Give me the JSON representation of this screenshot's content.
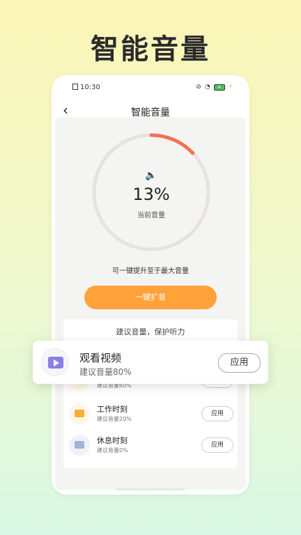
{
  "headline": "智能音量",
  "status_bar": {
    "time": "10:30",
    "battery": "4"
  },
  "nav": {
    "title": "智能音量"
  },
  "volume": {
    "percent_text": "13%",
    "label": "当前音量",
    "level": 0.13
  },
  "hint": "可一键提升至于最大音量",
  "boost_button": "一键扩音",
  "suggest": {
    "title": "建议音量，保护听力",
    "apply_label": "应用",
    "items": [
      {
        "name": "",
        "sub": "建议音量60%"
      },
      {
        "name": "工作时刻",
        "sub": "建议音量20%"
      },
      {
        "name": "休息时刻",
        "sub": "建议音量0%"
      }
    ]
  },
  "popup": {
    "name": "观看视频",
    "sub": "建议音量80%",
    "apply_label": "应用"
  },
  "colors": {
    "accent": "#ffa23a",
    "ring_progress": "#f4714f",
    "ring_track": "#e9e2dc",
    "video_icon": "#8a7fe8"
  },
  "icons": [
    "back-arrow-icon",
    "speaker-icon",
    "video-icon",
    "monitor-icon",
    "bed-icon",
    "alarm-off-icon",
    "wifi-icon",
    "battery-icon",
    "charging-icon"
  ]
}
